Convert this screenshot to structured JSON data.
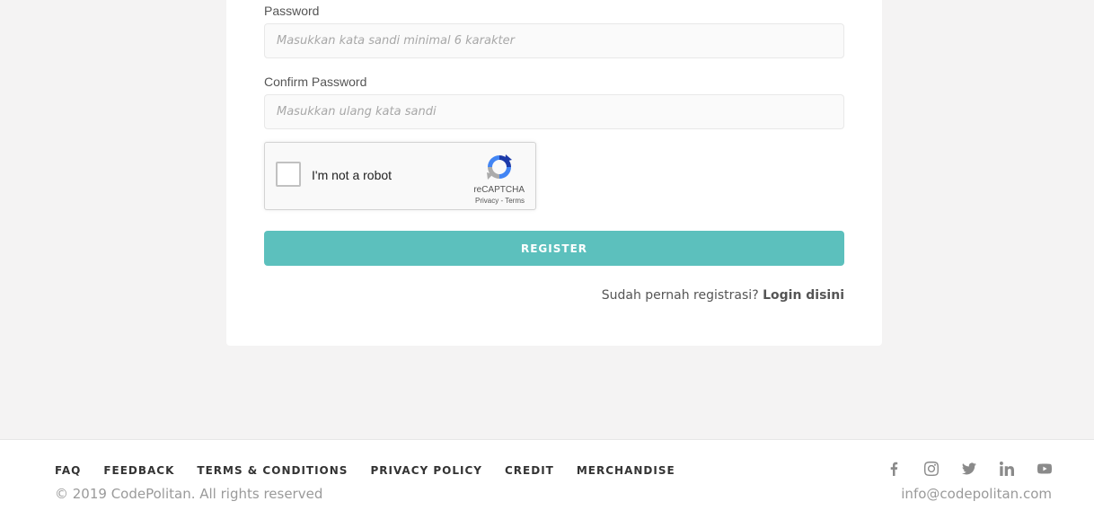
{
  "form": {
    "password_label": "Password",
    "password_placeholder": "Masukkan kata sandi minimal 6 karakter",
    "confirm_label": "Confirm Password",
    "confirm_placeholder": "Masukkan ulang kata sandi",
    "register_label": "REGISTER",
    "login_prompt": "Sudah pernah registrasi?",
    "login_link": "Login disini"
  },
  "captcha": {
    "text": "I'm not a robot",
    "brand": "reCAPTCHA",
    "links": "Privacy - Terms"
  },
  "footer": {
    "nav": [
      "FAQ",
      "FEEDBACK",
      "TERMS & CONDITIONS",
      "PRIVACY POLICY",
      "CREDIT",
      "MERCHANDISE"
    ],
    "copyright": "© 2019 CodePolitan. All rights reserved",
    "email": "info@codepolitan.com",
    "social_icons": [
      "facebook-icon",
      "instagram-icon",
      "twitter-icon",
      "linkedin-icon",
      "youtube-icon"
    ]
  },
  "colors": {
    "accent": "#5cc0bd",
    "background": "#f4f3f3"
  }
}
